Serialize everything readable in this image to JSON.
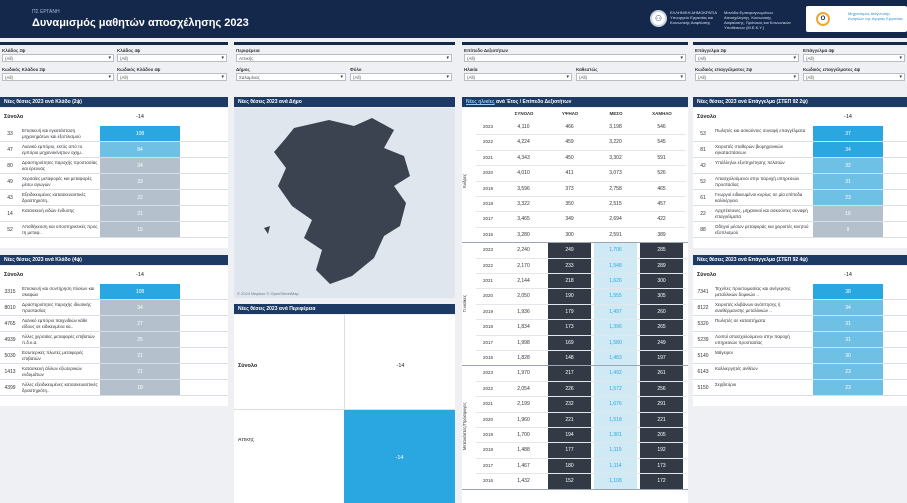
{
  "header": {
    "subtitle": "ΠΣ ΕΡΓΑΝΗ",
    "title": "Δυναμισμός μαθητών αποσχέλησης 2023",
    "gov_logo_label": "ΕΛΛΗΝΙΚΗ ΔΗΜΟΚΡΑΤΙΑ Υπουργείο Εργασίας και Κοινωνικής Ασφάλισης",
    "gov_logo_glyph": "⚇",
    "org_label": "Μονάδα Εμπειρογνωμόνων Απασχόλησης, Κοινωνικής Ασφάλισης, Πρόνοιας και Κοινωνικών Υποθέσεων (Μ.Ε.Κ.Υ.)",
    "corner_logo_glyph": "Ο",
    "corner_logo_text": "Μηχανισμός Διάγνωσης Αναγκών της Αγοράς Εργασίας"
  },
  "filters": {
    "g1": {
      "l1": "Κλάδος 2ψ",
      "v1": "(All)",
      "l2": "Κλάδος 4ψ",
      "v2": "(All)",
      "l3": "Κωδικός Κλάδου 2ψ",
      "v3": "(All)",
      "l4": "Κωδικός Κλάδου 4ψ",
      "v4": "(All)"
    },
    "g2": {
      "l1": "Περιφέρεια",
      "v1": "Αττικής",
      "l2": "Δήμος",
      "v2": "Σαλαμίνας",
      "l3": "Φύλο",
      "v3": "(All)"
    },
    "g3": {
      "l1": "Επίπεδο Δεξιοτήτων",
      "v1": "(All)",
      "l2": "Ηλικία",
      "v2": "(All)",
      "l3": "Καθεστώς",
      "v3": "(All)"
    },
    "g4": {
      "l1": "Επάγγελμα 2ψ",
      "v1": "(All)",
      "l2": "Επάγγελμα 4ψ",
      "v2": "(All)",
      "l3": "Κωδικός επαγγέλματος 2ψ",
      "v3": "(All)",
      "l4": "Κωδικός επαγγέλματος 4ψ",
      "v4": "(All)"
    }
  },
  "panels": {
    "k2_title": "Νέες θέσεις 2023 ανά Κλάδο (2ψ)",
    "k4_title": "Νέες θέσεις 2023 ανά Κλάδο (4ψ)",
    "dimos_title": "Νέες θέσεις 2023 ανά Δήμο",
    "perif_title": "Νέες θέσεις 2023 ανά Περιφέρεια",
    "edu_title_link": "Νέες ηλικίες",
    "edu_title_rest": " ανά Έτος / Επίπεδο Δεξιοτήτων",
    "e2_title": "Νέες θέσεις 2023 ανά Επάγγελμα (ΣΤΕΠ 92 2ψ)",
    "e4_title": "Νέες θέσεις 2023 ανά Επάγγελμα (ΣΤΕΠ 92 4ψ)",
    "total_label": "Σύνολο",
    "total_value": "-14"
  },
  "k2": {
    "rows": [
      {
        "code": "33",
        "name": "Επισκευή και εγκατάσταση μηχανημάτων και εξοπλισμού",
        "value": "108"
      },
      {
        "code": "47",
        "name": "Λιανικό εμπόριο, εκτός από το εμπόριο μηχανοκίνητων οχημ..",
        "value": "84"
      },
      {
        "code": "80",
        "name": "Δραστηριότητες παροχής προστασίας και έρευνας",
        "value": "34"
      },
      {
        "code": "49",
        "name": "Χερσαίες μεταφορές και μεταφορές μέσω αγωγών",
        "value": "33"
      },
      {
        "code": "43",
        "name": "Εξειδικευμένες κατασκευαστικές δραστηριότη..",
        "value": "22"
      },
      {
        "code": "14",
        "name": "Κατασκευή ειδών ένδυσης",
        "value": "21"
      },
      {
        "code": "52",
        "name": "Αποθήκευση και υποστηρικτικές προς τη μεταφ..",
        "value": "15"
      }
    ]
  },
  "k4": {
    "rows": [
      {
        "code": "3315",
        "name": "Επισκευή και συντήρηση πλοίων και σκαφών",
        "value": "108"
      },
      {
        "code": "8010",
        "name": "Δραστηριότητες παροχής ιδιωτικής προστασίας",
        "value": "34"
      },
      {
        "code": "4765",
        "name": "Λιανικό εμπόριο παιχνιδιών κάθε είδους σε ειδικευμένα κα..",
        "value": "27"
      },
      {
        "code": "4939",
        "name": "Άλλες χερσαίες μεταφορές επιβατών π.δ.κ.α.",
        "value": "25"
      },
      {
        "code": "5030",
        "name": "Εσωτερικές πλωτές μεταφορές επιβατών",
        "value": "21"
      },
      {
        "code": "1413",
        "name": "Κατασκευή άλλων εξωτερικών ενδυμάτων",
        "value": "21"
      },
      {
        "code": "4399",
        "name": "Άλλες εξειδικευμένες κατασκευαστικές δραστηριότη..",
        "value": "18"
      }
    ]
  },
  "map": {
    "attribution": "© 2024 Mapbox  © OpenStreetMap"
  },
  "perif": {
    "row_label": "Αττικής",
    "row_value": "-14"
  },
  "edu": {
    "headers": [
      "ΣΥΝΟΛΟ",
      "ΥΨΗΛΟ",
      "ΜΕΣΟ",
      "ΧΑΜΗΛΟ"
    ],
    "groups": [
      {
        "label": "Άνδρες",
        "rows": [
          {
            "year": "2023",
            "vals": [
              "4,110",
              "466",
              "3,198",
              "546"
            ]
          },
          {
            "year": "2022",
            "vals": [
              "4,224",
              "459",
              "3,220",
              "545"
            ]
          },
          {
            "year": "2021",
            "vals": [
              "4,343",
              "450",
              "3,302",
              "591"
            ]
          },
          {
            "year": "2020",
            "vals": [
              "4,010",
              "411",
              "3,073",
              "526"
            ]
          },
          {
            "year": "2019",
            "vals": [
              "3,596",
              "373",
              "2,758",
              "465"
            ]
          },
          {
            "year": "2018",
            "vals": [
              "3,322",
              "350",
              "2,515",
              "457"
            ]
          },
          {
            "year": "2017",
            "vals": [
              "3,465",
              "349",
              "2,694",
              "422"
            ]
          },
          {
            "year": "2016",
            "vals": [
              "3,280",
              "300",
              "2,591",
              "389"
            ]
          }
        ]
      },
      {
        "label": "Γυναίκες",
        "rows": [
          {
            "year": "2023",
            "vals": [
              "2,240",
              "249",
              "1,706",
              "285"
            ]
          },
          {
            "year": "2022",
            "vals": [
              "2,170",
              "233",
              "1,548",
              "289"
            ]
          },
          {
            "year": "2021",
            "vals": [
              "2,144",
              "218",
              "1,626",
              "300"
            ]
          },
          {
            "year": "2020",
            "vals": [
              "2,050",
              "190",
              "1,555",
              "305"
            ]
          },
          {
            "year": "2019",
            "vals": [
              "1,936",
              "179",
              "1,497",
              "260"
            ]
          },
          {
            "year": "2018",
            "vals": [
              "1,834",
              "173",
              "1,396",
              "265"
            ]
          },
          {
            "year": "2017",
            "vals": [
              "1,998",
              "169",
              "1,580",
              "249"
            ]
          },
          {
            "year": "2016",
            "vals": [
              "1,828",
              "148",
              "1,483",
              "197"
            ]
          }
        ]
      },
      {
        "label": "Μετανάστες/Πρόσφυγες",
        "rows": [
          {
            "year": "2023",
            "vals": [
              "1,970",
              "217",
              "1,492",
              "261"
            ]
          },
          {
            "year": "2022",
            "vals": [
              "2,054",
              "226",
              "1,572",
              "256"
            ]
          },
          {
            "year": "2021",
            "vals": [
              "2,199",
              "232",
              "1,676",
              "291"
            ]
          },
          {
            "year": "2020",
            "vals": [
              "1,960",
              "221",
              "1,518",
              "221"
            ]
          },
          {
            "year": "2019",
            "vals": [
              "1,700",
              "194",
              "1,301",
              "205"
            ]
          },
          {
            "year": "2018",
            "vals": [
              "1,488",
              "177",
              "1,119",
              "192"
            ]
          },
          {
            "year": "2017",
            "vals": [
              "1,467",
              "180",
              "1,114",
              "173"
            ]
          },
          {
            "year": "2016",
            "vals": [
              "1,432",
              "152",
              "1,108",
              "172"
            ]
          }
        ]
      }
    ]
  },
  "e2": {
    "rows": [
      {
        "code": "53",
        "name": "Πωλητές και ασκούντες συναφή επαγγέλματα",
        "value": "37"
      },
      {
        "code": "81",
        "name": "Χειριστές σταθερών βιομηχανικών εγκαταστάσεων",
        "value": "34"
      },
      {
        "code": "42",
        "name": "Υπάλληλοι εξυπηρέτησης πελατών",
        "value": "32"
      },
      {
        "code": "52",
        "name": "Απασχολούμενοι στην παροχή υπηρεσιών προστασίας",
        "value": "31"
      },
      {
        "code": "61",
        "name": "Γεωργοί ειδικευμένοι κυρίως σε μία επίπεδα καλλιέργεια",
        "value": "23"
      },
      {
        "code": "22",
        "name": "Αρχιτέκτονες, μηχανικοί και ασκούντες συναφή επαγγέλματα",
        "value": "16"
      },
      {
        "code": "88",
        "name": "Οδηγοί μέσων μεταφοράς και χειριστές κινητού εξοπλισμού",
        "value": "9"
      }
    ]
  },
  "e4": {
    "rows": [
      {
        "code": "7341",
        "name": "Τεχνίτες προετοιμασίας και ανέγερσης μεταλλικών δομικών ..",
        "value": "38"
      },
      {
        "code": "8122",
        "name": "Χειριστές κλιβάνων ανόπτησης ή αναθέρμανσης μεταλλικών ..",
        "value": "34"
      },
      {
        "code": "5320",
        "name": "Πωλητές σε καταστήματα",
        "value": "31"
      },
      {
        "code": "5239",
        "name": "Λοιποί απασχολούμενοι στην παροχή υπηρεσιών προστασίας",
        "value": "31"
      },
      {
        "code": "5140",
        "name": "Μάγειροι",
        "value": "30"
      },
      {
        "code": "6143",
        "name": "Καλλιεργητές ανθέων",
        "value": "23"
      },
      {
        "code": "5150",
        "name": "Σερβιτόροι",
        "value": "23"
      }
    ]
  },
  "colors": {
    "navy": "#13284b",
    "panel_header": "#1c3a64",
    "accent": "#2aa7e0",
    "mid_blue": "#6ec1e4",
    "light_blue": "#cfe9f5",
    "grey_cell": "#b4c0cc"
  }
}
